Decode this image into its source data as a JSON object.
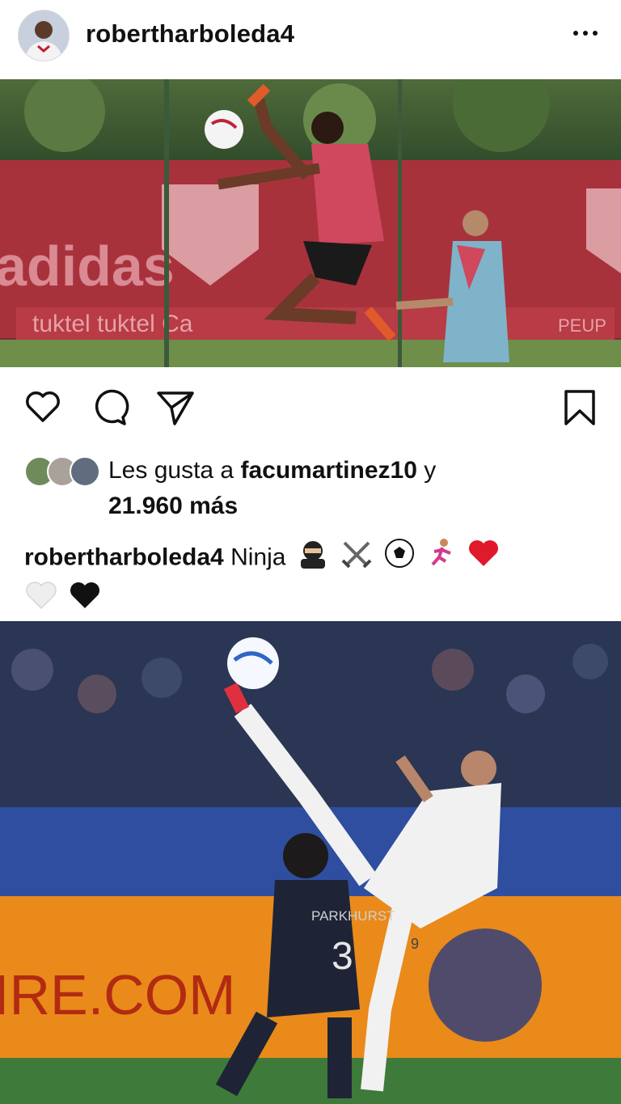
{
  "post": {
    "username": "robertharboleda4",
    "likes": {
      "prefix": "Les gusta a",
      "first_liker": "facumartinez10",
      "joiner": "y",
      "count": "21.960",
      "suffix": "más"
    },
    "caption": {
      "username": "robertharboleda4",
      "text": "Ninja",
      "emojis": [
        "ninja",
        "crossed-swords",
        "soccer-ball",
        "runner",
        "red-heart",
        "white-heart",
        "black-heart"
      ]
    }
  },
  "photo2": {
    "banner_text": "IRE.COM",
    "jersey_name": "PARKHURST",
    "jersey_number": "3",
    "jersey_number_2": "9"
  },
  "photo1": {
    "banner_brand": "adidas"
  },
  "colors": {
    "text": "#111111",
    "heart_red": "#e0192b"
  }
}
